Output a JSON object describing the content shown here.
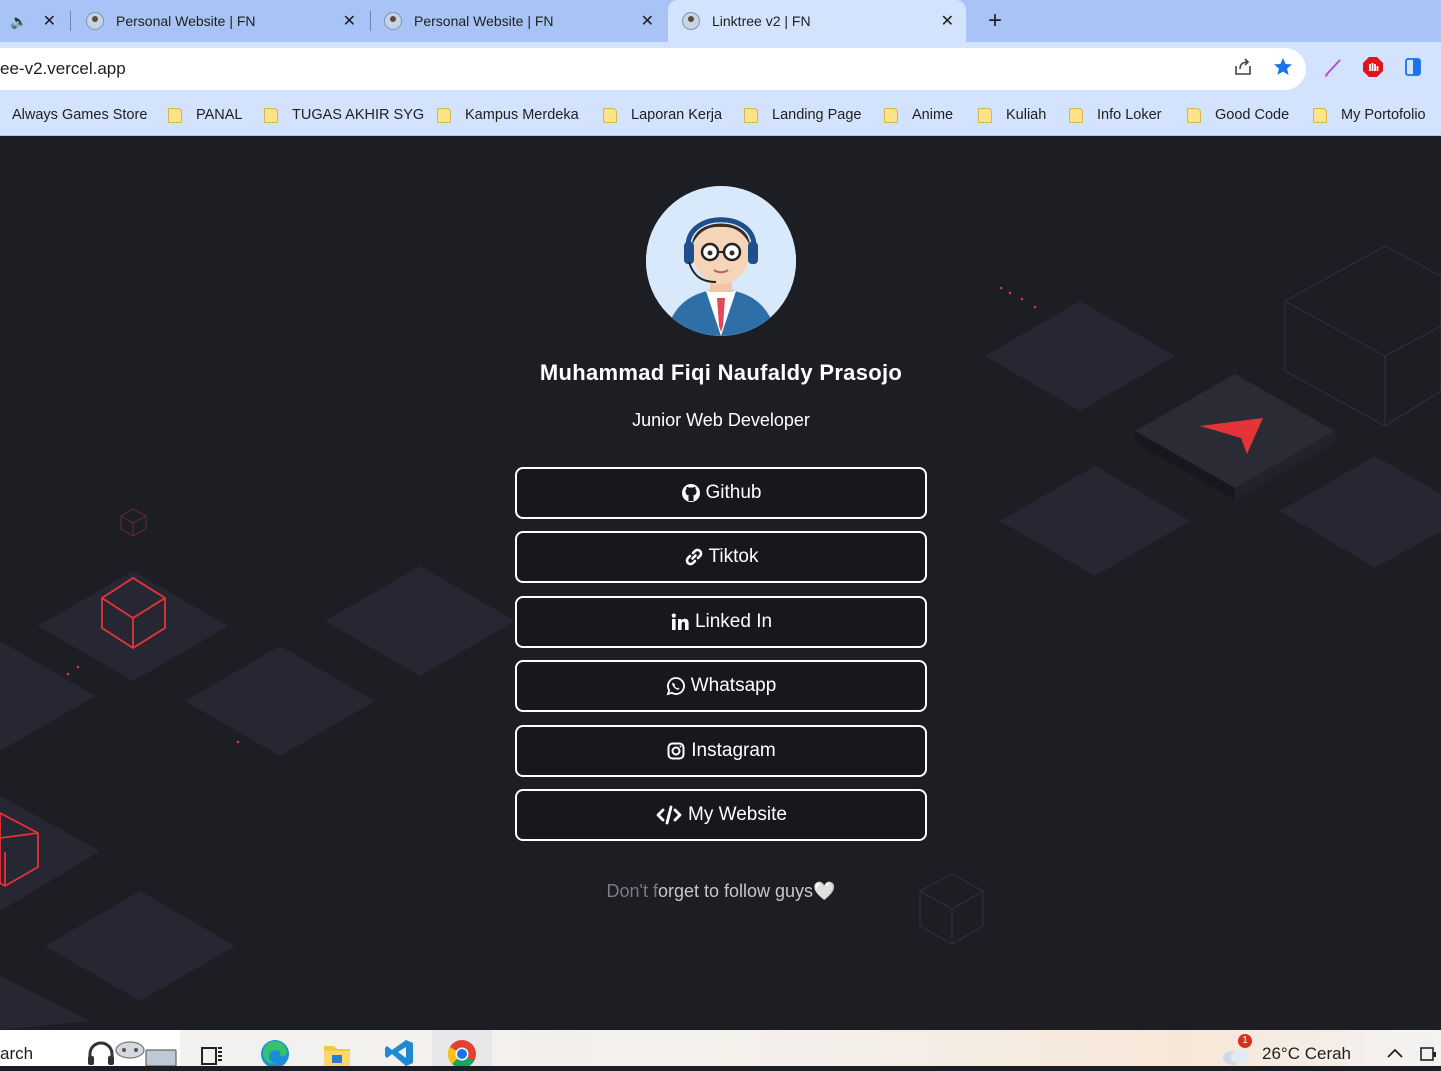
{
  "browser": {
    "tabs": [
      {
        "title": "Personal Website | FN",
        "close": "✕",
        "active": false
      },
      {
        "title": "Personal Website | FN",
        "close": "✕",
        "active": false
      },
      {
        "title": "Linktree v2 | FN",
        "close": "✕",
        "active": true
      }
    ],
    "first_tab_close": "✕",
    "new_tab": "+",
    "url": "ee-v2.vercel.app"
  },
  "bookmarks": [
    "Always Games Store",
    "PANAL",
    "TUGAS AKHIR SYG",
    "Kampus Merdeka",
    "Laporan Kerja",
    "Landing Page",
    "Anime",
    "Kuliah",
    "Info Loker",
    "Good Code",
    "My Portofolio"
  ],
  "profile": {
    "name": "Muhammad Fiqi Naufaldy Prasojo",
    "role": "Junior Web Developer"
  },
  "links": [
    {
      "label": "Github",
      "icon": "github-icon"
    },
    {
      "label": "Tiktok",
      "icon": "link-icon"
    },
    {
      "label": "Linked In",
      "icon": "linkedin-icon"
    },
    {
      "label": "Whatsapp",
      "icon": "whatsapp-icon"
    },
    {
      "label": "Instagram",
      "icon": "instagram-icon"
    },
    {
      "label": "My Website",
      "icon": "code-icon"
    }
  ],
  "footer": {
    "dim_part": "Don't f",
    "main_part": "orget to follow guys",
    "heart": "🤍"
  },
  "taskbar": {
    "search_text": "arch",
    "weather_badge": "1",
    "weather": "26°C  Cerah"
  },
  "colors": {
    "tab_strip": "#a8c3f5",
    "toolbar": "#d3e2fd",
    "page_bg": "#1d1d24",
    "accent_red": "#e5333a"
  }
}
